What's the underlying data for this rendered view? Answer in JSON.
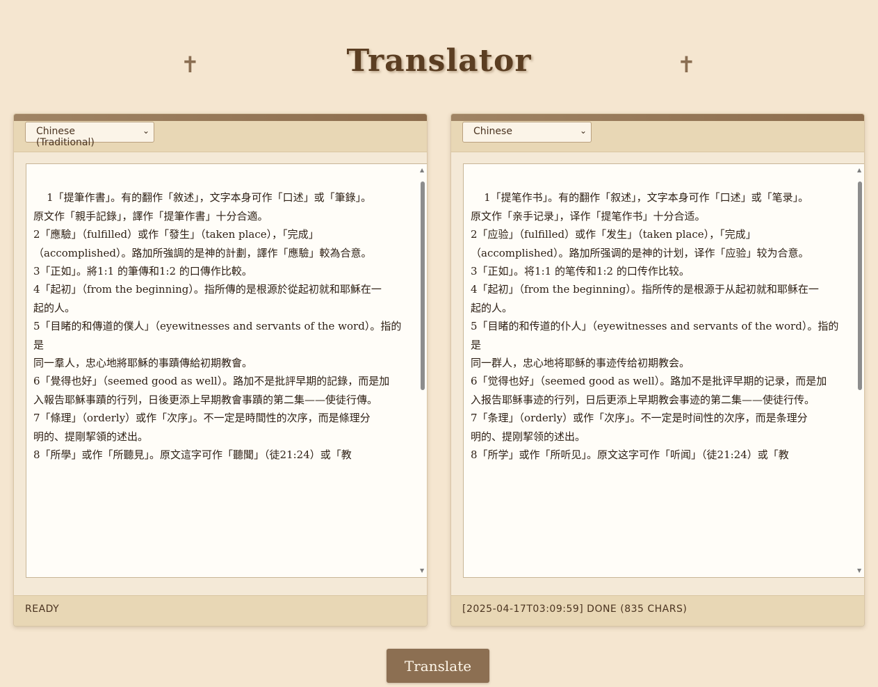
{
  "header": {
    "title": "Translator",
    "cross_left": "✝",
    "cross_right": "✝"
  },
  "source_panel": {
    "language": "Chinese (Traditional)",
    "text": "1「提筆作書」。有的翻作「敘述」，文字本身可作「口述」或「筆錄」。\n原文作「親手記錄」，譯作「提筆作書」十分合適。\n2「應驗」（fulfilled）或作「發生」（taken place），「完成」（accomplished）。路加所強調的是神的計劃，譯作「應驗」較為合意。\n3「正如」。將1:1 的筆傳和1:2 的口傳作比較。\n4「起初」（from the beginning）。指所傳的是根源於從起初就和耶穌在一\n起的人。\n5「目睹的和傳道的僕人」（eyewitnesses and servants of the word）。指的是\n同一羣人，忠心地將耶穌的事蹟傳給初期教會。\n6「覺得也好」（seemed good as well）。路加不是批評早期的記錄，而是加\n入報告耶穌事蹟的行列，日後更添上早期教會事蹟的第二集——使徒行傳。\n7「條理」（orderly）或作「次序」。不一定是時間性的次序，而是條理分\n明的、提剛挈領的述出。\n8「所學」或作「所聽見」。原文這字可作「聽聞」（徒21:24）或「教",
    "status": "READY"
  },
  "target_panel": {
    "language": "Chinese",
    "text": "1「提笔作书」。有的翻作「叙述」，文字本身可作「口述」或「笔录」。\n原文作「亲手记录」，译作「提笔作书」十分合适。\n2「应验」（fulfilled）或作「发生」（taken place），「完成」（accomplished）。路加所强调的是神的计划，译作「应验」较为合意。\n3「正如」。将1:1 的笔传和1:2 的口传作比较。\n4「起初」（from the beginning）。指所传的是根源于从起初就和耶稣在一\n起的人。\n5「目睹的和传道的仆人」（eyewitnesses and servants of the word）。指的是\n同一群人，忠心地将耶稣的事迹传给初期教会。\n6「觉得也好」（seemed good as well）。路加不是批评早期的记录，而是加\n入报告耶稣事迹的行列，日后更添上早期教会事迹的第二集——使徒行传。\n7「条理」（orderly）或作「次序」。不一定是时间性的次序，而是条理分\n明的、提刚挈领的述出。\n8「所学」或作「所听见」。原文这字可作「听闻」（徒21:24）或「教",
    "status": "[2025-04-17T03:09:59] DONE (835 CHARS)"
  },
  "actions": {
    "translate_label": "Translate"
  },
  "colors": {
    "background": "#f5e6d0",
    "panel_header": "#e8d7b5",
    "button": "#8c6f52",
    "title": "#5b3e22"
  }
}
